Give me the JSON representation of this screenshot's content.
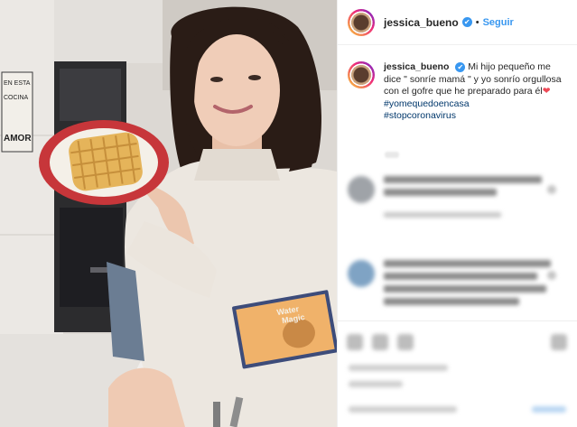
{
  "header": {
    "username": "jessica_bueno",
    "separator": "•",
    "follow_label": "Seguir",
    "verified_glyph": "✔"
  },
  "caption": {
    "username": "jessica_bueno",
    "text": "Mi hijo pequeño me dice \" sonríe mamá \" y yo sonrío orgullosa con el gofre que he preparado para él",
    "heart": "❤",
    "hashtags": [
      "#yomequedoencasa",
      "#stopcoronavirus"
    ]
  },
  "photo": {
    "sign_text": [
      "EN ESTA",
      "COCINA",
      "AMOR"
    ],
    "book_title": [
      "Water",
      "Magic"
    ]
  },
  "colors": {
    "link": "#3897f0",
    "hashtag": "#00376b",
    "verified": "#3897f0",
    "heart": "#ed4956"
  },
  "icons": [
    "verified-badge-icon",
    "heart-emoji-icon"
  ]
}
